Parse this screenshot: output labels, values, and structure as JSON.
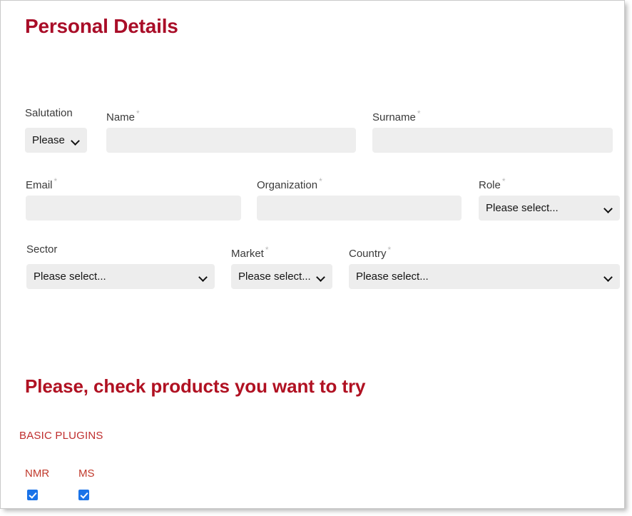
{
  "page": {
    "section_title": "Personal Details",
    "products_title": "Please, check products you want to try",
    "group_label": "BASIC PLUGINS"
  },
  "colors": {
    "heading_red": "#a90d28",
    "products_red": "#b01122",
    "group_red": "#bf2d2d",
    "label_gray": "#3a3a3a",
    "field_bg": "#eeeeee",
    "checkbox_blue": "#1a73e8"
  },
  "form": {
    "fields": [
      {
        "name": "salutation",
        "label": "Salutation",
        "required": false,
        "type": "select",
        "value": "Please",
        "placeholder": "Please select..."
      },
      {
        "name": "first_name",
        "label": "Name",
        "required": true,
        "type": "text",
        "value": "",
        "placeholder": ""
      },
      {
        "name": "surname",
        "label": "Surname",
        "required": true,
        "type": "text",
        "value": "",
        "placeholder": ""
      },
      {
        "name": "email",
        "label": "Email",
        "required": true,
        "type": "text",
        "value": "",
        "placeholder": ""
      },
      {
        "name": "organization",
        "label": "Organization",
        "required": true,
        "type": "text",
        "value": "",
        "placeholder": ""
      },
      {
        "name": "role",
        "label": "Role",
        "required": true,
        "type": "select",
        "value": "Please select...",
        "placeholder": "Please select..."
      },
      {
        "name": "sector",
        "label": "Sector",
        "required": false,
        "type": "select",
        "value": "Please select...",
        "placeholder": "Please select..."
      },
      {
        "name": "market",
        "label": "Market",
        "required": true,
        "type": "select",
        "value": "Please select...",
        "placeholder": "Please select..."
      },
      {
        "name": "country",
        "label": "Country",
        "required": true,
        "type": "select",
        "value": "Please select...",
        "placeholder": "Please select..."
      }
    ],
    "required_marker": "*"
  },
  "products": {
    "items": [
      {
        "name": "nmr",
        "label": "NMR",
        "checked": true
      },
      {
        "name": "ms",
        "label": "MS",
        "checked": true
      }
    ]
  }
}
